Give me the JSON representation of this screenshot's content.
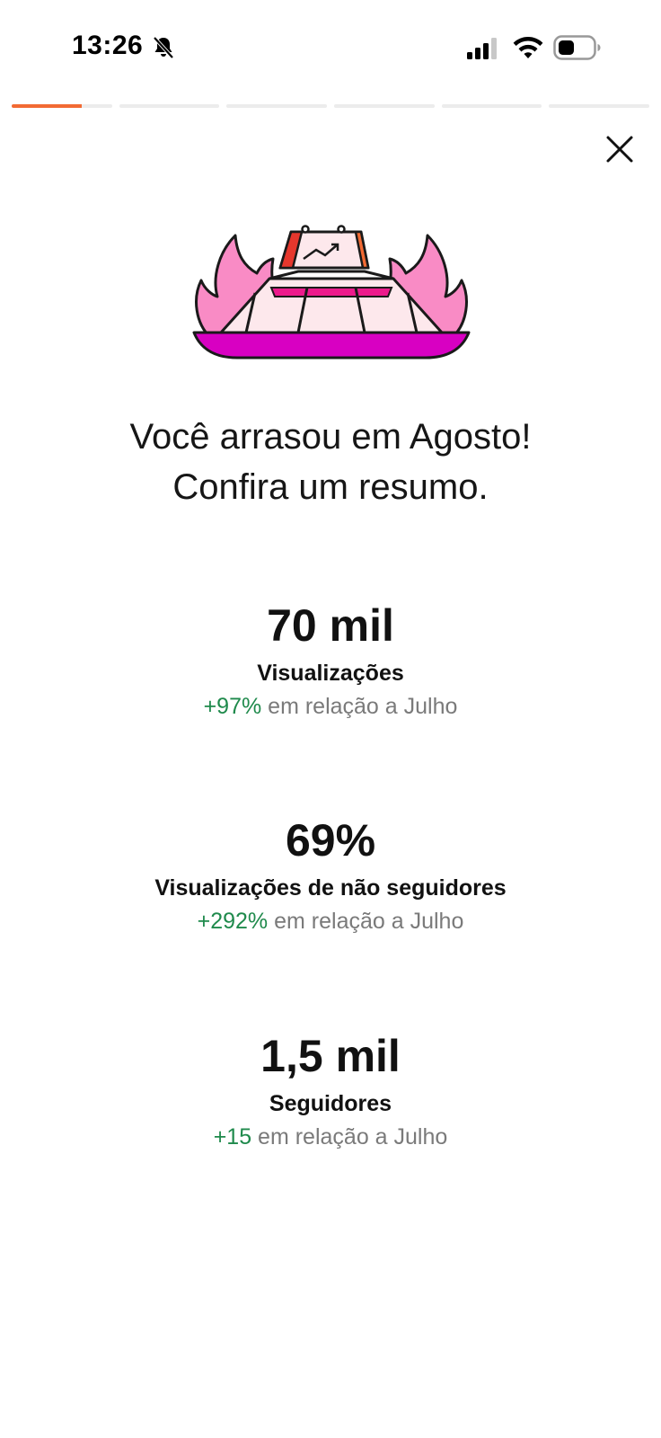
{
  "status_bar": {
    "time": "13:26",
    "icons": [
      "bell-slash-icon",
      "cellular-signal-icon",
      "wifi-icon",
      "battery-icon"
    ]
  },
  "stories": {
    "segments": 6,
    "current_index": 0,
    "current_progress": 0.7
  },
  "close_icon": "close-icon",
  "illustration_icon": "stadium-fire-chart-icon",
  "headline": {
    "line1": "Você arrasou em Agosto!",
    "line2": "Confira um resumo."
  },
  "stats": [
    {
      "value": "70 mil",
      "label": "Visualizações",
      "delta": "+97%",
      "comparison": " em relação a Julho"
    },
    {
      "value": "69%",
      "label": "Visualizações de não seguidores",
      "delta": "+292%",
      "comparison": " em relação a Julho"
    },
    {
      "value": "1,5 mil",
      "label": "Seguidores",
      "delta": "+15",
      "comparison": " em relação a Julho"
    }
  ],
  "colors": {
    "accent": "#f26a33",
    "positive": "#1f8a4c",
    "muted_text": "#7a7a7a",
    "pink_flame": "#f98bc5",
    "magenta_base": "#d800c2"
  }
}
